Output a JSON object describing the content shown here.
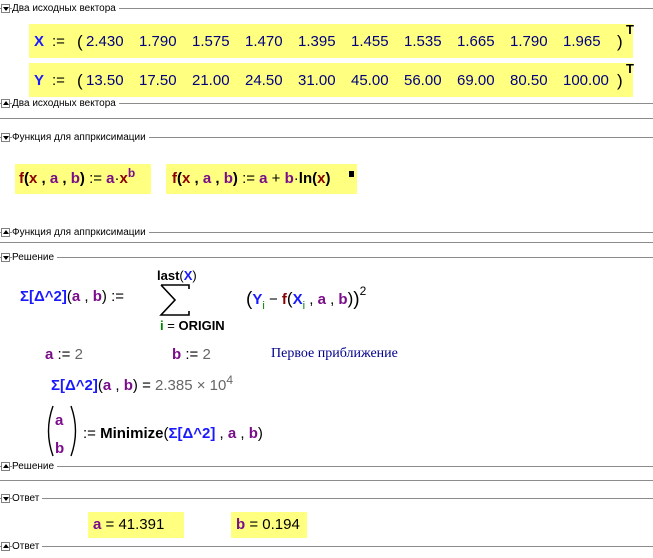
{
  "regions": {
    "vectors_label": "Два исходных вектора",
    "func_label": "Функция для аппркисимации",
    "solution_label": "Решение",
    "answer_label": "Ответ"
  },
  "vectors": {
    "x_name": "X",
    "y_name": "Y",
    "assign": ":=",
    "transpose": "T",
    "x_values": [
      "2.430",
      "1.790",
      "1.575",
      "1.470",
      "1.395",
      "1.455",
      "1.535",
      "1.665",
      "1.790",
      "1.965"
    ],
    "y_values": [
      "13.50",
      "17.50",
      "21.00",
      "24.50",
      "31.00",
      "45.00",
      "56.00",
      "69.00",
      "80.50",
      "100.00"
    ]
  },
  "functions": {
    "f_name": "f",
    "x": "x",
    "a": "a",
    "b": "b",
    "ln": "ln"
  },
  "solution": {
    "sigma_name": "Σ[Δ^2]",
    "sum_upper_fn": "last",
    "sum_upper_arg": "X",
    "sum_lower_index": "i",
    "sum_lower_eq": "=",
    "sum_lower_val": "ORIGIN",
    "sq": "2",
    "index_i": "i",
    "a_init": "2",
    "b_init": "2",
    "note": "Первое приближение",
    "eval_mantissa": "2.385",
    "eval_times": "×",
    "eval_base": "10",
    "eval_exp": "4",
    "minimize": "Minimize"
  },
  "answer": {
    "a_value": "41.391",
    "b_value": "0.194"
  }
}
